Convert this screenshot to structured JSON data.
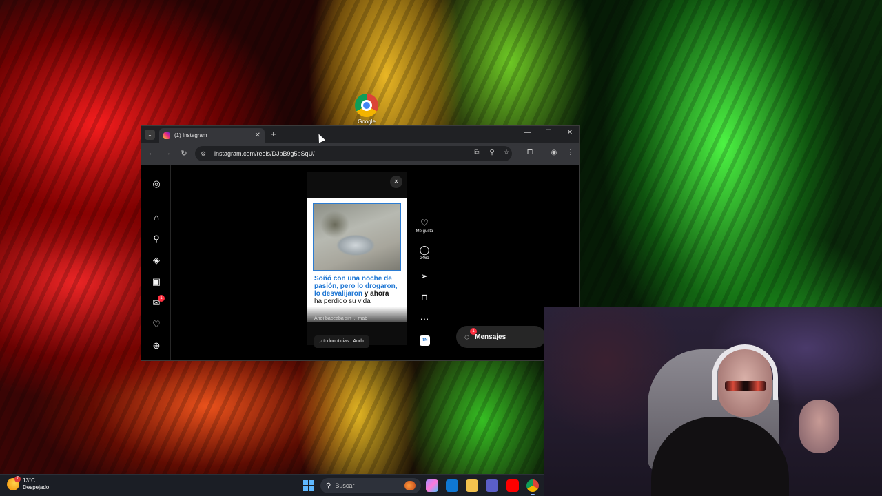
{
  "desktop": {
    "icon_label": "Google"
  },
  "browser": {
    "tab_title": "(1) Instagram",
    "tab_close": "✕",
    "new_tab": "+",
    "tab_search": "⌄",
    "window_minimize": "—",
    "window_maximize": "☐",
    "window_close": "✕",
    "back": "←",
    "forward": "→",
    "reload": "↻",
    "url": "instagram.com/reels/DJpB9g5pSqU/"
  },
  "instagram": {
    "sidebar_icons": [
      "instagram-logo",
      "home",
      "search",
      "explore",
      "reels",
      "messages",
      "notifications",
      "create"
    ],
    "messages_badge": "1",
    "reel": {
      "caption_blue_1": "Soñó con una noche de pasión, pero lo drogaron,",
      "caption_blue_2": "lo desvalijaron",
      "caption_dark": " y ahora",
      "caption_line_last": "ha perdido su vida",
      "tn_logo": "TN",
      "bottom_text": "Anoi baceaba sin ... mab",
      "audio": "♫ todonoticias · Audio"
    },
    "actions": {
      "like_label": "Me gusta",
      "comment_count": "2461"
    },
    "avatar_label": "TN",
    "mensajes_label": "Mensajes",
    "mensajes_badge": "1"
  },
  "taskbar": {
    "temperature": "13°C",
    "condition": "Despejado",
    "weather_badge": "7",
    "search_placeholder": "Buscar"
  }
}
